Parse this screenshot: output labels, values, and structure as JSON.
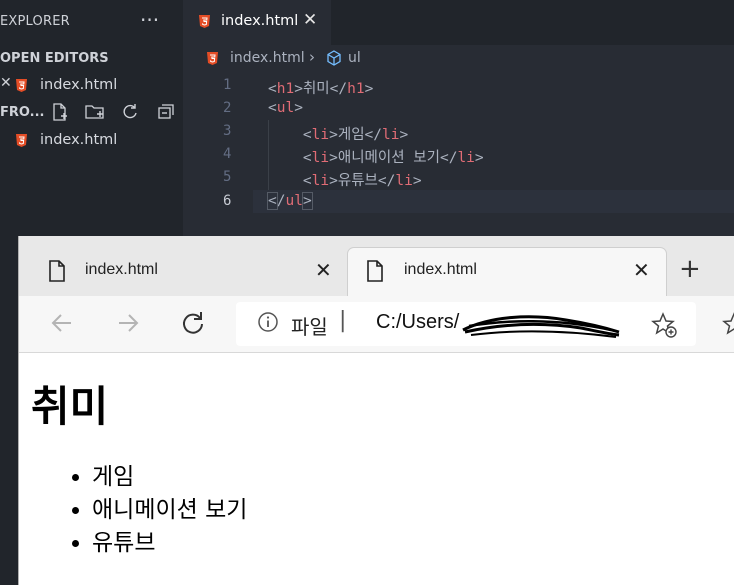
{
  "editor": {
    "explorer_title": "EXPLORER",
    "more": "···",
    "open_editors_label": "OPEN EDITORS",
    "open_file": "index.html",
    "folder_label": "FRO...",
    "tree_file": "index.html",
    "tab_title": "index.html",
    "tab_close": "✕",
    "breadcrumb_file": "index.html",
    "breadcrumb_sep": "›",
    "breadcrumb_symbol": "ul",
    "line_numbers": [
      "1",
      "2",
      "3",
      "4",
      "5",
      "6"
    ],
    "lines": [
      {
        "indent": "",
        "open": "h1",
        "text": "취미",
        "close": "h1"
      },
      {
        "indent": "",
        "open": "ul",
        "text": "",
        "close": ""
      },
      {
        "indent": "    ",
        "open": "li",
        "text": "게임",
        "close": "li"
      },
      {
        "indent": "    ",
        "open": "li",
        "text": "애니메이션 보기",
        "close": "li"
      },
      {
        "indent": "    ",
        "open": "li",
        "text": "유튜브",
        "close": "li"
      },
      {
        "indent": "",
        "open": "",
        "text": "",
        "close": "ul"
      }
    ],
    "colors": {
      "tag": "#e06c75",
      "html_icon": "#e44d26",
      "background": "#282c34"
    }
  },
  "browser": {
    "tabs": [
      {
        "title": "index.html",
        "close": "✕"
      },
      {
        "title": "index.html",
        "close": "✕"
      }
    ],
    "new_tab": "+",
    "address": {
      "scheme_label": "파일",
      "divider": "|",
      "url": "C:/Users/"
    },
    "page": {
      "heading": "취미",
      "items": [
        "게임",
        "애니메이션 보기",
        "유튜브"
      ]
    }
  }
}
